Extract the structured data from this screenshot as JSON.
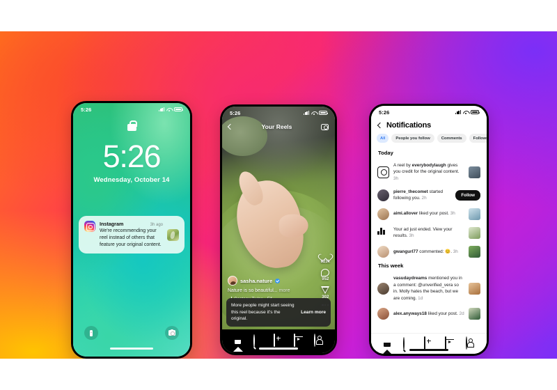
{
  "background": {
    "gradient_colors": [
      "#ff7a18",
      "#ffc400",
      "#ff3d4a",
      "#f51f86",
      "#c81fd6",
      "#7b2ff7"
    ]
  },
  "phone_lock": {
    "status": {
      "time": "5:26"
    },
    "clock": "5:26",
    "date": "Wednesday, October 14",
    "notification": {
      "app": "Instagram",
      "time": "3h ago",
      "text": "We're recommending your reel instead of others that feature your original content."
    },
    "actions": {
      "flashlight": "Flashlight",
      "camera": "Camera"
    }
  },
  "phone_reel": {
    "status": {
      "time": "5:26"
    },
    "header": {
      "title": "Your Reels",
      "back": "Back",
      "camera": "Camera"
    },
    "rail": {
      "likes": "823k",
      "comments": "952",
      "shares": "302",
      "more": "More options"
    },
    "post": {
      "username": "sasha.nature",
      "verified": true,
      "caption": "Nature is so beautiful...",
      "more_label": "more",
      "audio": "Cocteau Twins · Fif..."
    },
    "banner": {
      "text": "More people might start seeing this reel because it's the original.",
      "cta": "Learn more"
    },
    "nav": [
      "Home",
      "Search",
      "Create",
      "Reels",
      "Profile"
    ]
  },
  "phone_notifications": {
    "status": {
      "time": "5:26"
    },
    "title": "Notifications",
    "filters": [
      {
        "label": "All",
        "active": true
      },
      {
        "label": "People you follow",
        "active": false
      },
      {
        "label": "Comments",
        "active": false
      },
      {
        "label": "Follows",
        "active": false
      }
    ],
    "sections": [
      {
        "heading": "Today",
        "items": [
          {
            "icon": "reel-credit-icon",
            "user": "everybodylaugh",
            "prefix": "A reel by ",
            "text": " gives you credit for the original content.",
            "time": "3h",
            "has_thumb": true,
            "thumb_color": "#5b6a78"
          },
          {
            "icon": "avatar",
            "user": "pierre_thecomet",
            "prefix": "",
            "text": " started following you.",
            "time": "2h",
            "action": "Follow",
            "avatar_color": "#3d3a44"
          },
          {
            "icon": "avatar",
            "user": "aimi.allover",
            "prefix": "",
            "text": " liked your post.",
            "time": "3h",
            "has_thumb": true,
            "thumb_color": "#8fb6c9",
            "avatar_color": "#c9a882"
          },
          {
            "icon": "chart-icon",
            "user": "",
            "prefix": "",
            "text": "Your ad just ended. View your results.",
            "time": "3h",
            "has_thumb": true,
            "thumb_color": "#9ab87a"
          },
          {
            "icon": "avatar",
            "user": "gwangurl77",
            "prefix": "",
            "text": " commented: 😊.",
            "time": "3h",
            "has_thumb": true,
            "thumb_color": "#4e7a4a",
            "avatar_color": "#d8c0a8"
          }
        ]
      },
      {
        "heading": "This week",
        "items": [
          {
            "icon": "avatar",
            "user": "vasudaydreams",
            "prefix": "",
            "text": " mentioned you in a comment: @unverified_vera so in. Molly hates the beach, but we are coming.",
            "time": "1d",
            "has_thumb": true,
            "thumb_color": "#c98f5a",
            "avatar_color": "#6b5a4a"
          },
          {
            "icon": "avatar",
            "user": "alex.anyways18",
            "prefix": "",
            "text": " liked your post.",
            "time": "2d",
            "has_thumb": true,
            "thumb_color": "#3f6b4a",
            "avatar_color": "#b07a5a"
          }
        ]
      }
    ],
    "nav": [
      "Home",
      "Search",
      "Create",
      "Reels",
      "Profile"
    ]
  }
}
